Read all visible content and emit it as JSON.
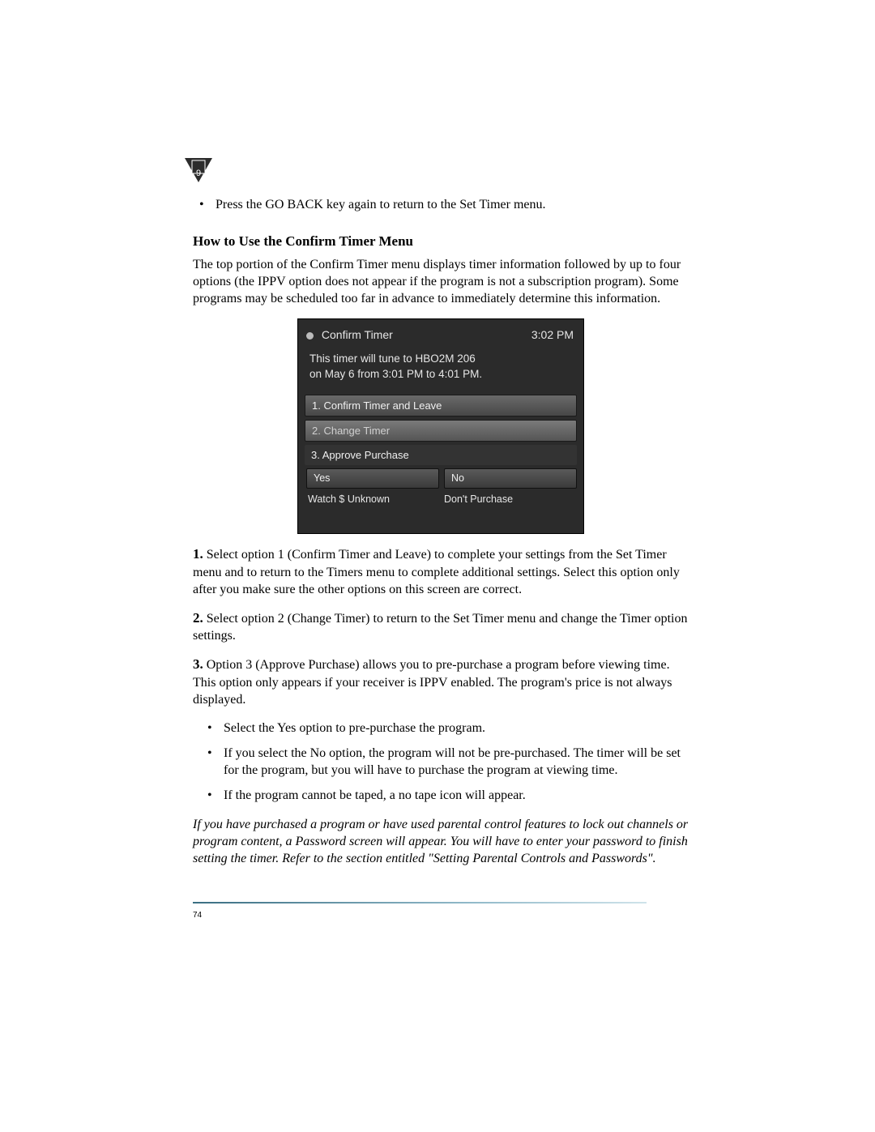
{
  "tab": {
    "number": "9"
  },
  "intro_bullet": "Press the GO BACK key again to return to the Set Timer menu.",
  "heading": "How to Use the Confirm Timer Menu",
  "intro_para": "The top portion of the Confirm Timer menu displays timer information followed by up to four options (the IPPV option does not appear if the program is not a subscription program). Some programs may be scheduled too far in advance to immediately determine this information.",
  "figure": {
    "title": "Confirm Timer",
    "time": "3:02 PM",
    "message_l1": "This timer will tune to HBO2M 206",
    "message_l2": "on May 6 from 3:01 PM to 4:01 PM.",
    "opt1": "1.  Confirm Timer and Leave",
    "opt2": "2.  Change Timer",
    "opt3": "3.  Approve Purchase",
    "yes": "Yes",
    "no": "No",
    "watch": "Watch $ Unknown",
    "dont": "Don't Purchase"
  },
  "steps": {
    "s1": "Select option 1 (Confirm Timer and Leave) to complete your settings from the Set Timer menu and to return to the Timers menu to complete additional settings. Select this option only after you make sure the other options on this screen are correct.",
    "s2": "Select option 2 (Change Timer) to return to the Set Timer menu and change the Timer option settings.",
    "s3": "Option 3 (Approve Purchase) allows you to pre-purchase a program before viewing time. This option only appears if your receiver is IPPV enabled. The program's price is not always displayed."
  },
  "sub_bullets": {
    "b1": "Select the Yes option to pre-purchase the program.",
    "b2": "If you select the No option, the program will not be pre-purchased. The timer will be set for the program, but you will have to purchase the program at viewing time.",
    "b3": "If the program cannot be taped, a no tape icon will appear."
  },
  "note": "If you have purchased a program or have used parental control features to lock out channels or program content, a Password screen will appear. You will have to enter your password to finish setting the timer. Refer to the section entitled \"Setting Parental Controls and Passwords\".",
  "page_number": "74"
}
